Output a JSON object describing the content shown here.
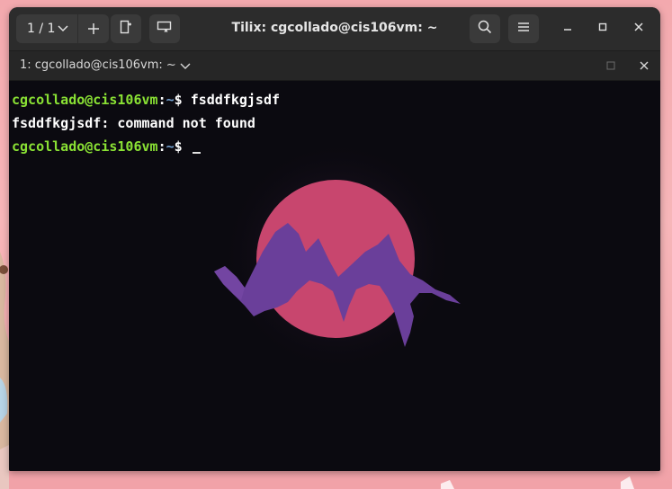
{
  "window": {
    "title": "Tilix: cgcollado@cis106vm: ~",
    "session_counter": "1 / 1"
  },
  "tab": {
    "title": "1: cgcollado@cis106vm: ~"
  },
  "terminal": {
    "lines": [
      {
        "user": "cgcollado@cis106vm",
        "sep": ":",
        "path": "~",
        "symbol": "$ ",
        "command": "fsddfkgjsdf"
      },
      {
        "output": "fsddfkgjsdf: command not found"
      },
      {
        "user": "cgcollado@cis106vm",
        "sep": ":",
        "path": "~",
        "symbol": "$ ",
        "command": ""
      }
    ]
  },
  "icons": {
    "session": "chevron-down-icon",
    "add": "plus-icon",
    "split": "split-terminal-icon",
    "sync": "sync-input-icon",
    "search": "search-icon",
    "menu": "hamburger-menu-icon",
    "minimize": "minimize-icon",
    "maximize": "maximize-icon",
    "close": "close-icon"
  },
  "colors": {
    "prompt_user": "#8ae234",
    "prompt_path": "#729fcf",
    "terminal_bg": "#0b0a10",
    "sun": "#c8466e",
    "mountain": "#6a3f9a"
  }
}
